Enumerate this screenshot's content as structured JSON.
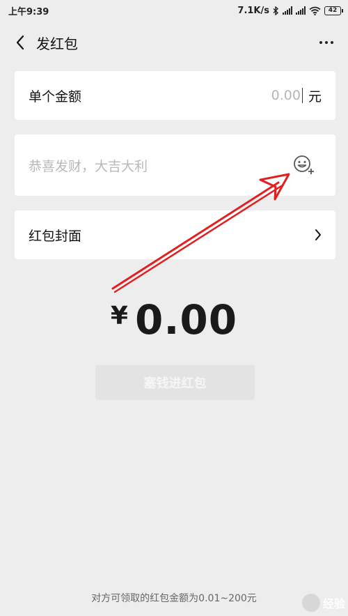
{
  "status_bar": {
    "time": "上午9:39",
    "speed": "7.1K/s",
    "battery": "42",
    "icons": [
      "bluetooth-icon",
      "signal-icon",
      "signal-icon",
      "wifi-icon",
      "battery-icon"
    ]
  },
  "nav": {
    "title": "发红包",
    "icons": [
      "back-arrow-icon",
      "more-dots-icon"
    ]
  },
  "amount_row": {
    "label": "单个金额",
    "placeholder": "0.00",
    "unit": "元"
  },
  "blessing_row": {
    "placeholder": "恭喜发财，大吉大利",
    "icon": "emoji-add-icon"
  },
  "cover_row": {
    "label": "红包封面",
    "icon": "chevron-right-icon"
  },
  "total": {
    "currency": "¥",
    "value": "0.00"
  },
  "submit": {
    "label": "塞钱进红包"
  },
  "footer": {
    "note": "对方可领取的红包金额为0.01~200元"
  },
  "watermark": {
    "text": "经验"
  },
  "colors": {
    "background": "#ededed",
    "card": "#ffffff",
    "annotation_arrow": "#e02020",
    "button_disabled": "#e3e3e3"
  }
}
